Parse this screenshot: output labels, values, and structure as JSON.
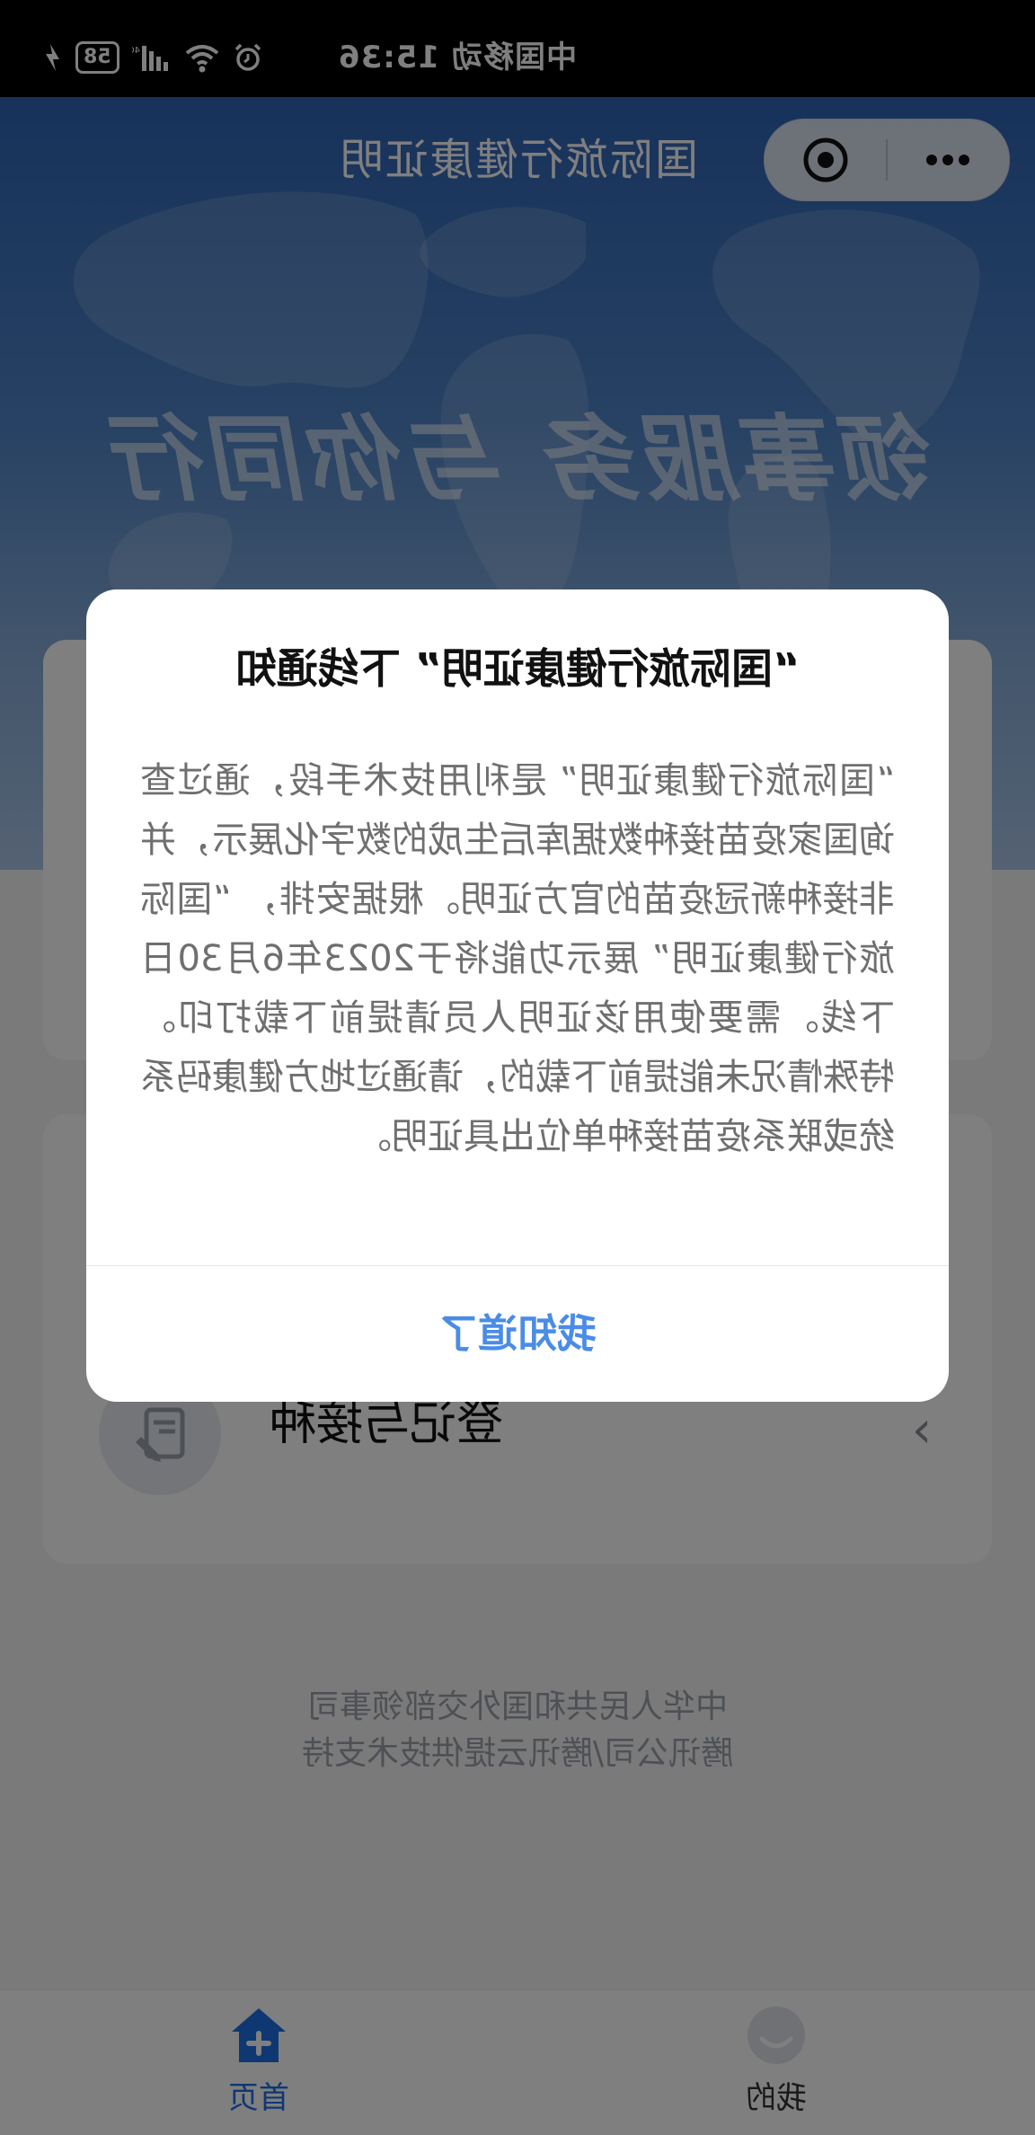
{
  "status_bar": {
    "carrier_time": "中国移动 15:36",
    "battery": "58",
    "icons": [
      "charging-bolt-icon",
      "battery-icon",
      "signal-icon",
      "wifi-icon",
      "alarm-icon"
    ]
  },
  "nav": {
    "title": "国际旅行健康证明",
    "capsule": [
      "more-icon",
      "close-target-icon"
    ]
  },
  "hero": {
    "slogan": "领事服务 与你同行"
  },
  "main": {
    "row_label": "登记与接种"
  },
  "footer": {
    "line1": "中华人民共和国外交部领事司",
    "line2": "腾讯公司/腾讯云提供技术支持"
  },
  "tabbar": {
    "home_label": "首页",
    "mine_label": "我的"
  },
  "modal": {
    "title": "“国际旅行健康证明” 下线通知",
    "body": "“国际旅行健康证明” 是利用技术手段，通过查询国家疫苗接种数据库后生成的数字化展示，并非接种新冠疫苗的官方证明。根据安排， “国际旅行健康证明” 展示功能将于2023年6月30日下线。需要使用该证明人员请提前下载打印。 特殊情况未能提前下载的，请通过地方健康码系统或联系疫苗接种单位出具证明。",
    "button": "我知道了"
  },
  "colors": {
    "accent": "#1f6fe5",
    "modal_button": "#4a8ce6",
    "status_bar_bg": "#000000"
  }
}
